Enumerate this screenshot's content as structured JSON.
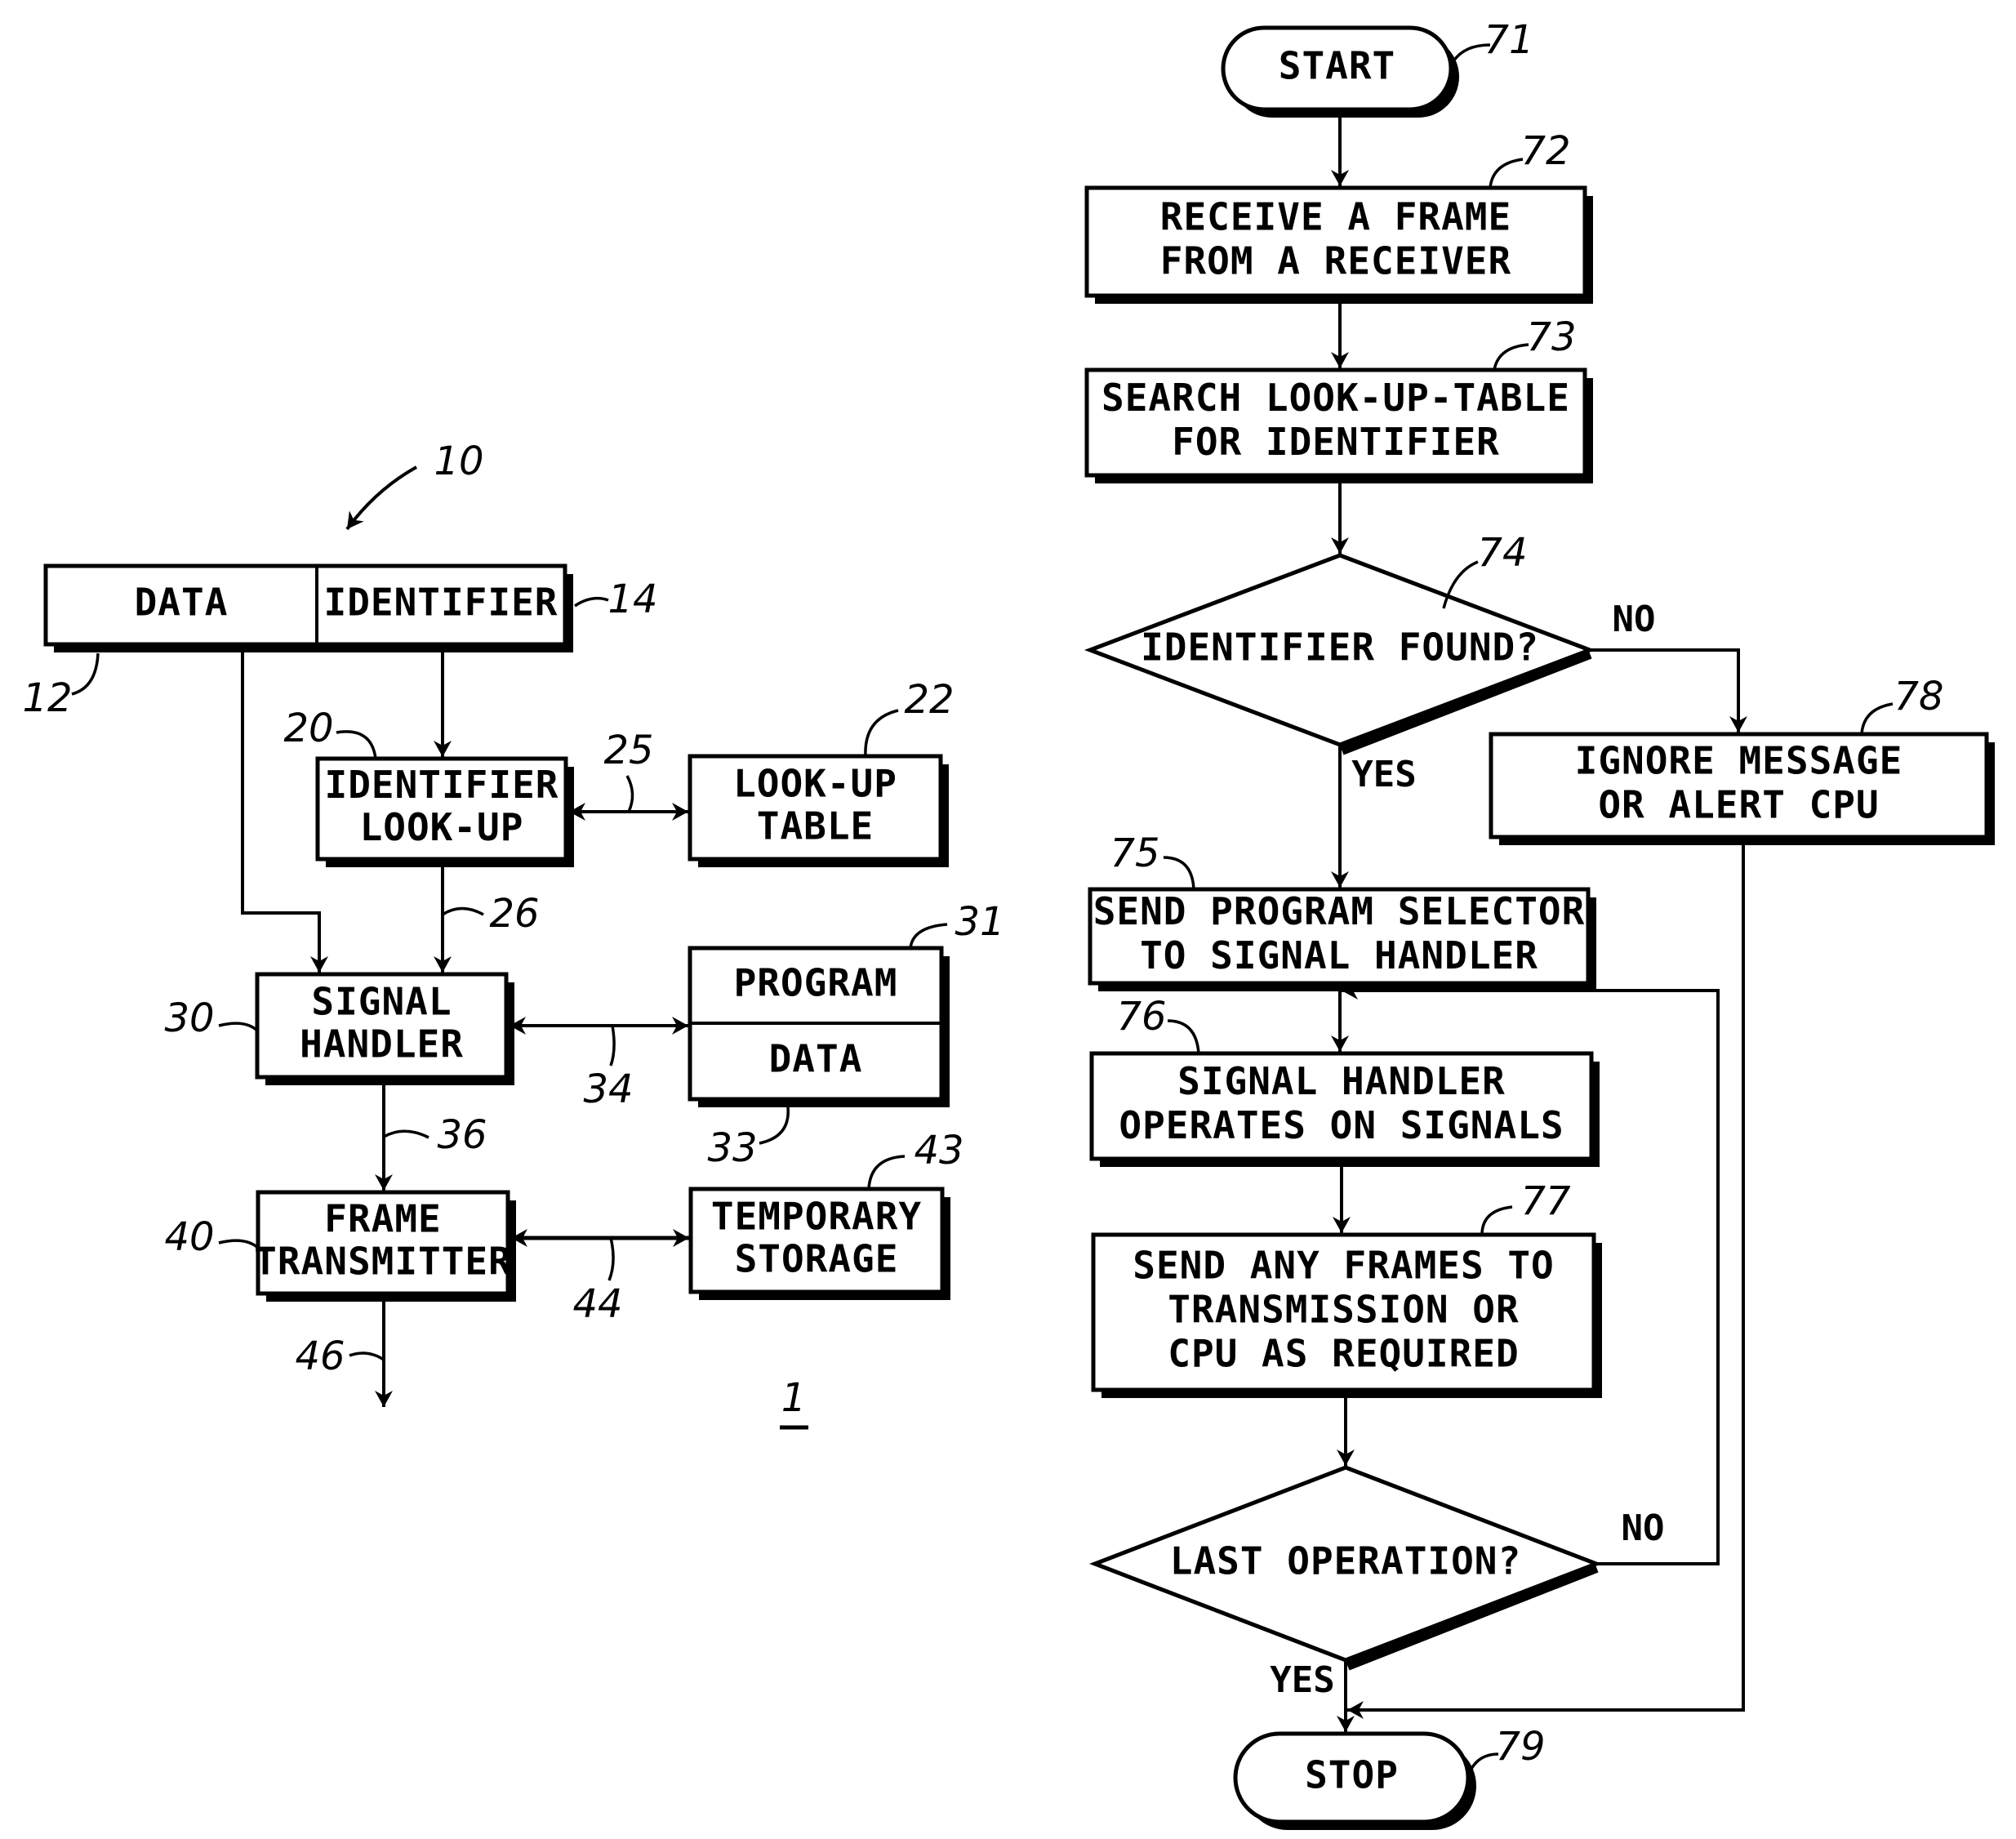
{
  "figure_label": "1",
  "colors": {
    "ink": "#000000",
    "paper": "#ffffff"
  },
  "block_diagram": {
    "ref": "10",
    "frame": {
      "data_field": {
        "label": "DATA",
        "ref": "12"
      },
      "identifier_field": {
        "label": "IDENTIFIER",
        "ref": "14"
      }
    },
    "blocks": [
      {
        "id": "identifier-lookup",
        "lines": [
          "IDENTIFIER",
          "LOOK-UP"
        ],
        "ref": "20"
      },
      {
        "id": "lookup-table",
        "lines": [
          "LOOK-UP",
          "TABLE"
        ],
        "ref": "22"
      },
      {
        "id": "signal-handler",
        "lines": [
          "SIGNAL",
          "HANDLER"
        ],
        "ref": "30"
      },
      {
        "id": "program-data",
        "sections": [
          "PROGRAM",
          "DATA"
        ],
        "ref_top": "31",
        "ref_bottom": "33"
      },
      {
        "id": "frame-transmitter",
        "lines": [
          "FRAME",
          "TRANSMITTER"
        ],
        "ref": "40"
      },
      {
        "id": "temporary-storage",
        "lines": [
          "TEMPORARY",
          "STORAGE"
        ],
        "ref": "43"
      }
    ],
    "connections": [
      {
        "from": "identifier-field",
        "to": "identifier-lookup",
        "ref": ""
      },
      {
        "from": "data-field",
        "to": "signal-handler",
        "ref": ""
      },
      {
        "from": "identifier-lookup",
        "to": "lookup-table",
        "bidirectional": true,
        "ref": "25"
      },
      {
        "from": "identifier-lookup",
        "to": "signal-handler",
        "ref": "26"
      },
      {
        "from": "signal-handler",
        "to": "program-data",
        "bidirectional": true,
        "ref": "34"
      },
      {
        "from": "signal-handler",
        "to": "frame-transmitter",
        "ref": "36"
      },
      {
        "from": "frame-transmitter",
        "to": "temporary-storage",
        "bidirectional": true,
        "ref": "44"
      },
      {
        "from": "frame-transmitter",
        "to": "output",
        "ref": "46"
      }
    ]
  },
  "flowchart": {
    "nodes": [
      {
        "id": "start",
        "type": "terminal",
        "lines": [
          "START"
        ],
        "ref": "71"
      },
      {
        "id": "receive-frame",
        "type": "process",
        "lines": [
          "RECEIVE A FRAME",
          "FROM A RECEIVER"
        ],
        "ref": "72"
      },
      {
        "id": "search-table",
        "type": "process",
        "lines": [
          "SEARCH LOOK-UP-TABLE",
          "FOR IDENTIFIER"
        ],
        "ref": "73"
      },
      {
        "id": "identifier-found",
        "type": "decision",
        "lines": [
          "IDENTIFIER FOUND?"
        ],
        "ref": "74"
      },
      {
        "id": "send-program-selector",
        "type": "process",
        "lines": [
          "SEND PROGRAM SELECTOR",
          "TO SIGNAL HANDLER"
        ],
        "ref": "75"
      },
      {
        "id": "handler-operates",
        "type": "process",
        "lines": [
          "SIGNAL HANDLER",
          "OPERATES ON SIGNALS"
        ],
        "ref": "76"
      },
      {
        "id": "send-frames",
        "type": "process",
        "lines": [
          "SEND ANY FRAMES TO",
          "TRANSMISSION OR",
          "CPU AS REQUIRED"
        ],
        "ref": "77"
      },
      {
        "id": "ignore-message",
        "type": "process",
        "lines": [
          "IGNORE MESSAGE",
          "OR ALERT CPU"
        ],
        "ref": "78"
      },
      {
        "id": "last-operation",
        "type": "decision",
        "lines": [
          "LAST OPERATION?"
        ],
        "ref": ""
      },
      {
        "id": "stop",
        "type": "terminal",
        "lines": [
          "STOP"
        ],
        "ref": "79"
      }
    ],
    "edges": [
      {
        "from": "start",
        "to": "receive-frame",
        "label": ""
      },
      {
        "from": "receive-frame",
        "to": "search-table",
        "label": ""
      },
      {
        "from": "search-table",
        "to": "identifier-found",
        "label": ""
      },
      {
        "from": "identifier-found",
        "to": "send-program-selector",
        "label": "YES"
      },
      {
        "from": "identifier-found",
        "to": "ignore-message",
        "label": "NO"
      },
      {
        "from": "send-program-selector",
        "to": "handler-operates",
        "label": ""
      },
      {
        "from": "handler-operates",
        "to": "send-frames",
        "label": ""
      },
      {
        "from": "send-frames",
        "to": "last-operation",
        "label": ""
      },
      {
        "from": "last-operation",
        "to": "stop",
        "label": "YES"
      },
      {
        "from": "last-operation",
        "to": "handler-operates",
        "label": "NO"
      },
      {
        "from": "ignore-message",
        "to": "stop",
        "label": ""
      }
    ]
  }
}
